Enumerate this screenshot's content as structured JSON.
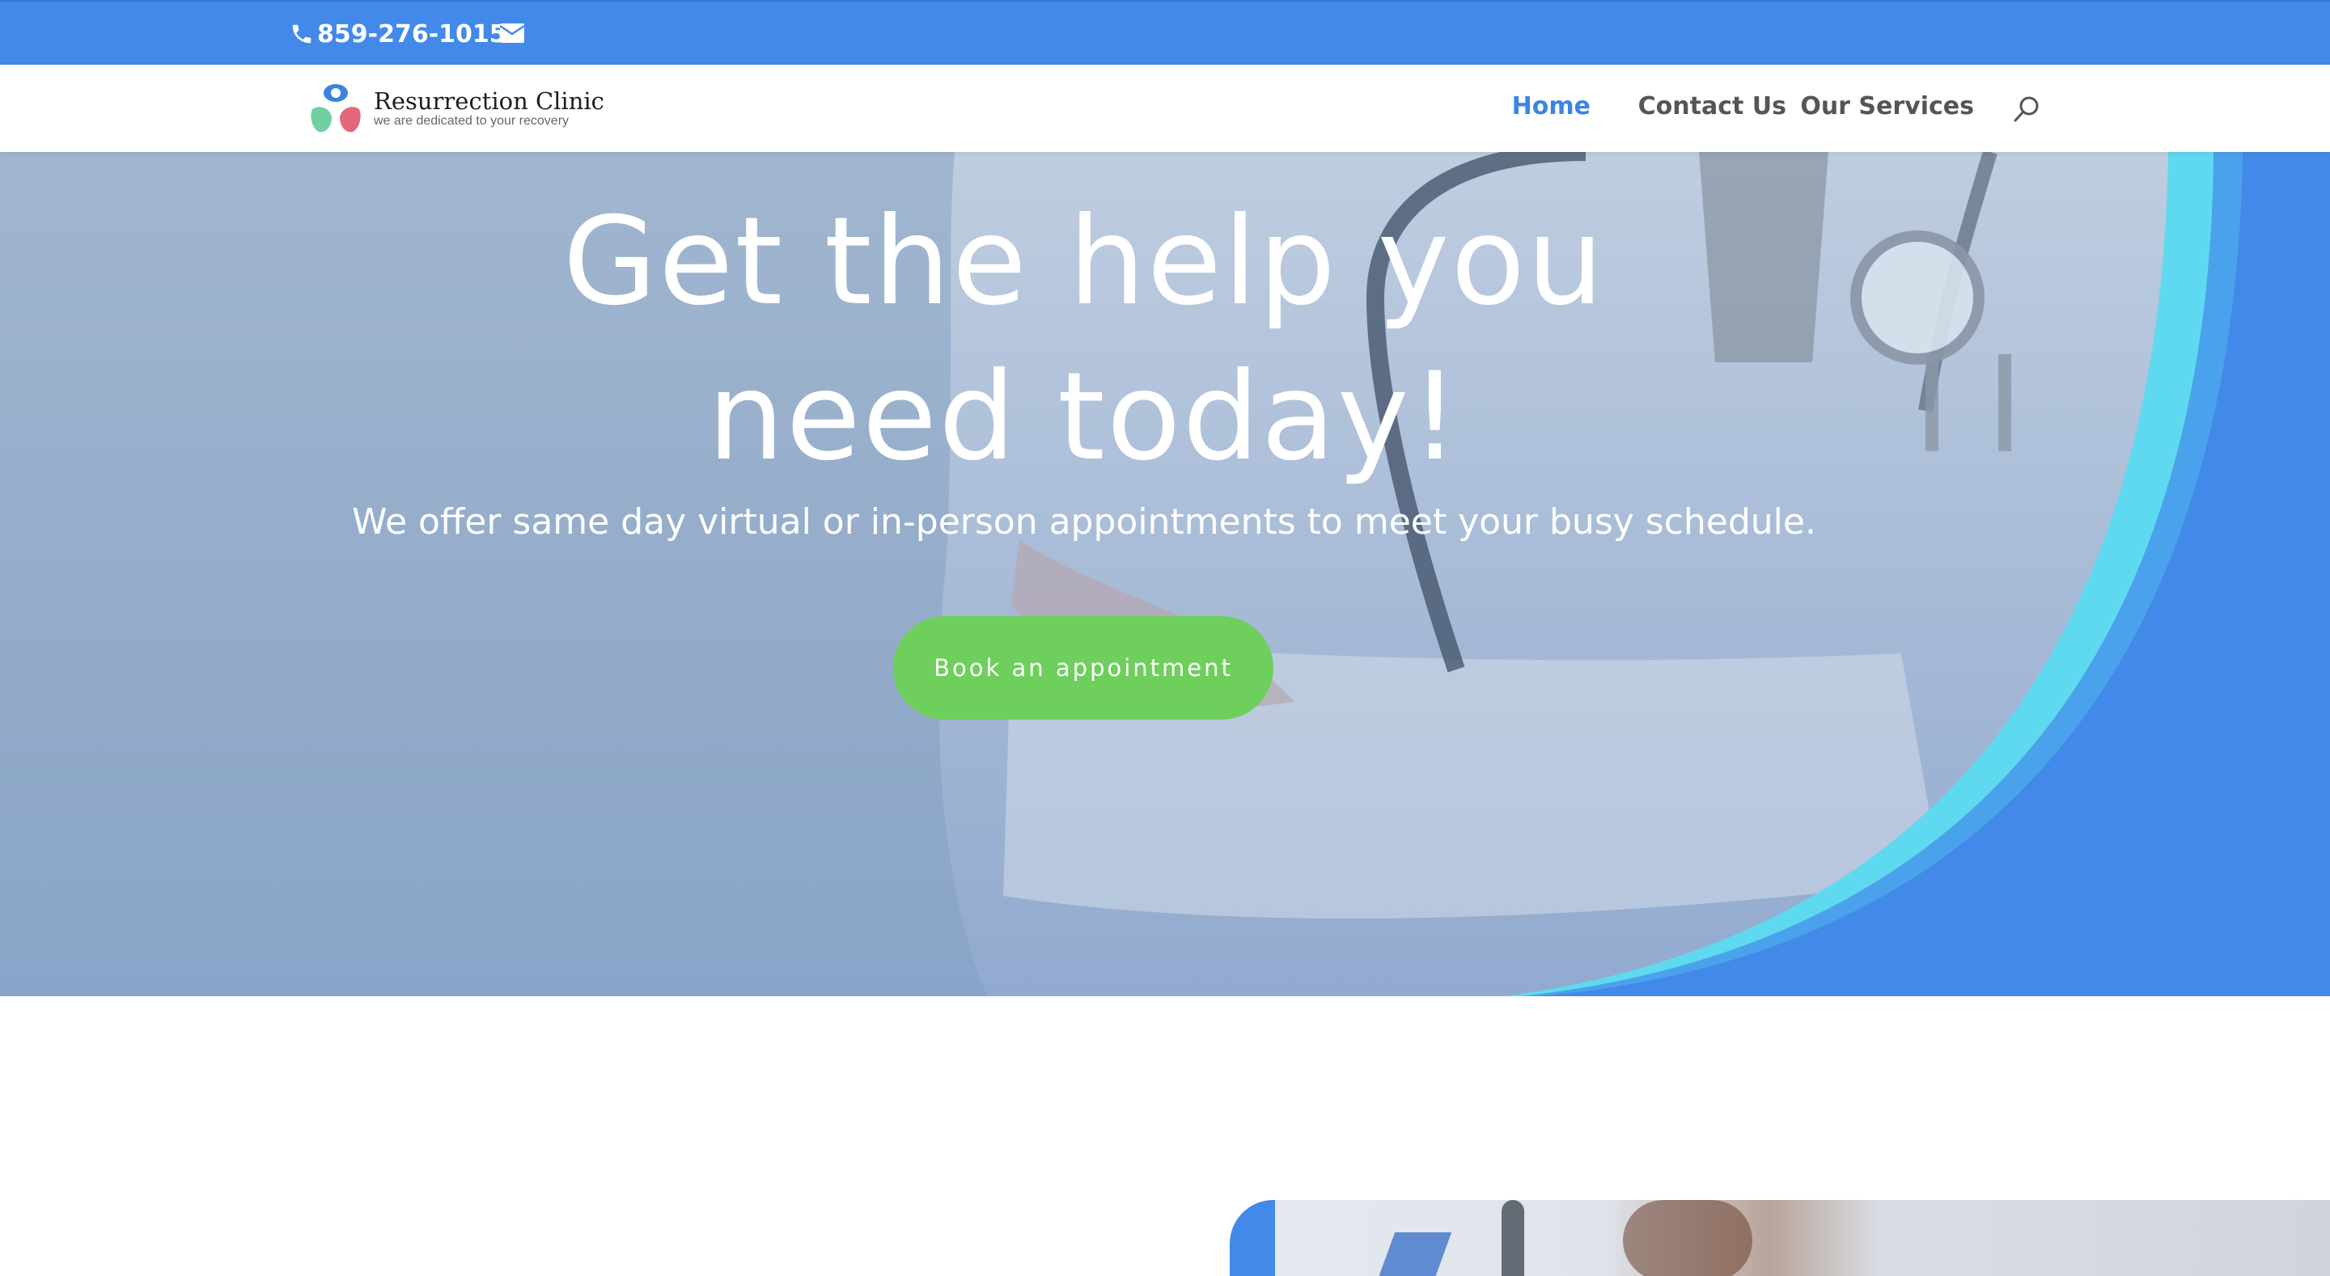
{
  "topbar": {
    "phone": "859-276-1015",
    "phone_icon": "phone-icon",
    "mail_icon": "mail-icon",
    "color": "#4289ea"
  },
  "header": {
    "logo": {
      "name": "Resurrection Clinic",
      "tagline": "we are dedicated to your recovery"
    },
    "nav": [
      {
        "label": "Home",
        "active": true
      },
      {
        "label": "Contact Us",
        "active": false
      },
      {
        "label": "Our Services",
        "active": false
      }
    ],
    "search_icon": "search-icon",
    "active_color": "#3c84e6"
  },
  "hero": {
    "title_line1": "Get the help you",
    "title_line2": "need today!",
    "subtitle": "We offer same day virtual or in-person appointments to meet your busy schedule.",
    "cta_label": "Book an appointment",
    "cta_color": "#6ecf5c",
    "accent_colors": [
      "#4289ea",
      "#5fd9f0",
      "#4aa2ec"
    ]
  }
}
